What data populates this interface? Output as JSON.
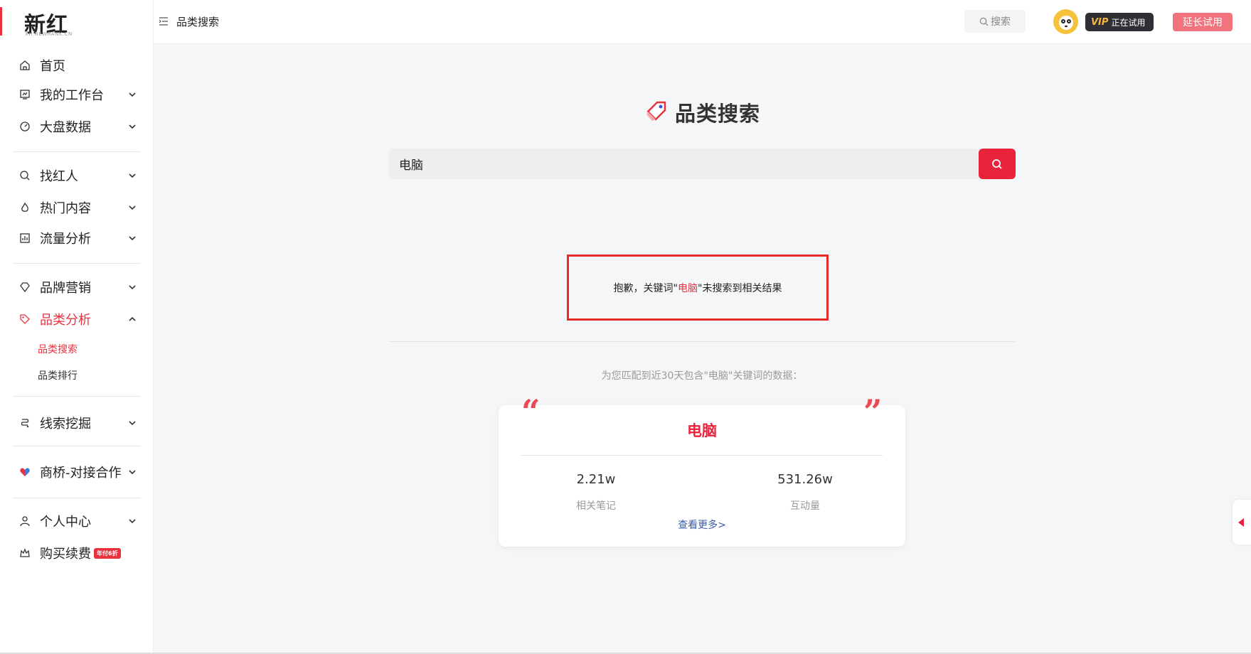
{
  "brand": {
    "name": "新红",
    "sub": "XH.NEWRANK.CN",
    "accent": "#e8323f"
  },
  "sidebar": {
    "items": [
      {
        "label": "首页",
        "icon": "home-icon"
      },
      {
        "label": "我的工作台",
        "icon": "workbench-icon"
      },
      {
        "label": "大盘数据",
        "icon": "dashboard-icon"
      },
      {
        "label": "找红人",
        "icon": "search-person-icon"
      },
      {
        "label": "热门内容",
        "icon": "fire-icon"
      },
      {
        "label": "流量分析",
        "icon": "chart-icon"
      },
      {
        "label": "品牌营销",
        "icon": "diamond-icon"
      },
      {
        "label": "品类分析",
        "icon": "tag-icon"
      },
      {
        "label": "线索挖掘",
        "icon": "link-icon"
      },
      {
        "label": "商桥-对接合作",
        "icon": "heart-icon"
      },
      {
        "label": "个人中心",
        "icon": "user-icon"
      },
      {
        "label": "购买续费",
        "icon": "crown-icon",
        "badge": "年付6折"
      }
    ],
    "sub_items": [
      {
        "label": "品类搜索"
      },
      {
        "label": "品类排行"
      }
    ]
  },
  "header": {
    "breadcrumb": "品类搜索",
    "search_label": "搜索",
    "vip": "VIP",
    "vip_status": "正在试用",
    "extend_label": "延长试用"
  },
  "main": {
    "title": "品类搜索",
    "search_value": "电脑",
    "message_prefix": "抱歉，关键词\"",
    "message_keyword": "电脑",
    "message_suffix": "\"未搜索到相关结果",
    "hint": "为您匹配到近30天包含\"电脑\"关键词的数据：",
    "card": {
      "title": "电脑",
      "stats": [
        {
          "value": "2.21w",
          "label": "相关笔记"
        },
        {
          "value": "531.26w",
          "label": "互动量"
        }
      ],
      "more_label": "查看更多>"
    }
  }
}
